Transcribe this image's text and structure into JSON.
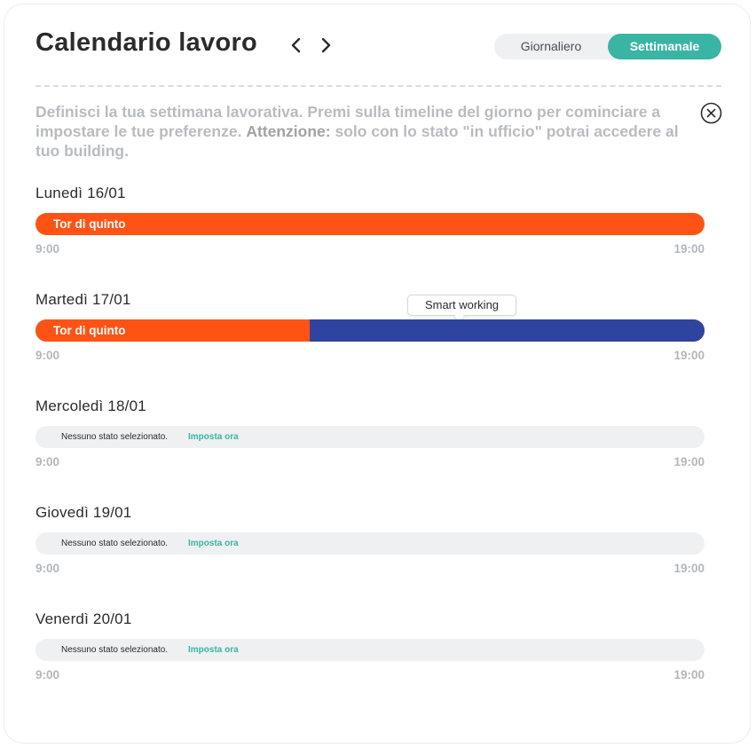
{
  "header": {
    "title": "Calendario lavoro",
    "view_toggle": {
      "daily": "Giornaliero",
      "weekly": "Settimanale",
      "selected": "weekly"
    }
  },
  "info": {
    "text_1": "Definisci la tua settimana lavorativa. Premi sulla timeline del giorno per cominciare a impostare le tue preferenze.",
    "bold": "Attenzione:",
    "text_2": "solo con lo stato \"in ufficio\" potrai accedere al tuo building."
  },
  "tooltip": "Smart working",
  "colors": {
    "office": "#ff5316",
    "smart_working": "#2f449f",
    "accent": "#3ab5a4",
    "empty": "#eef0f2"
  },
  "days": [
    {
      "label": "Lunedì 16/01",
      "segment_label": "Tor di quinto",
      "start": "9:00",
      "end": "19:00"
    },
    {
      "label": "Martedì 17/01",
      "segment_label": "Tor di quinto",
      "start": "9:00",
      "end": "19:00",
      "office_fraction": 0.41
    },
    {
      "label": "Mercoledì 18/01",
      "empty_text": "Nessuno stato selezionato.",
      "empty_link": "Imposta ora",
      "start": "9:00",
      "end": "19:00"
    },
    {
      "label": "Giovedì 19/01",
      "empty_text": "Nessuno stato selezionato.",
      "empty_link": "Imposta ora",
      "start": "9:00",
      "end": "19:00"
    },
    {
      "label": "Venerdì 20/01",
      "empty_text": "Nessuno stato selezionato.",
      "empty_link": "Imposta ora",
      "start": "9:00",
      "end": "19:00"
    }
  ]
}
